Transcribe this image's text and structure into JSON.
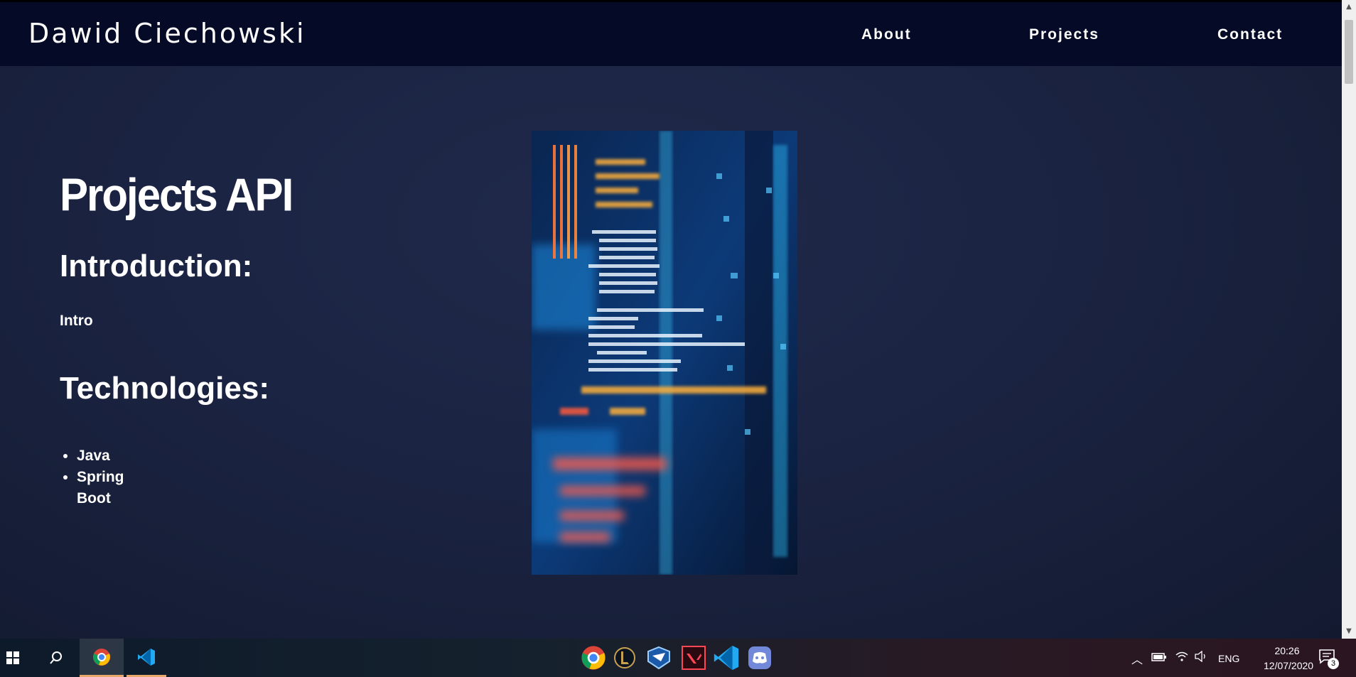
{
  "navbar": {
    "brand": "Dawid Ciechowski",
    "links": [
      "About",
      "Projects",
      "Contact"
    ]
  },
  "project": {
    "title": "Projects API",
    "intro_heading": "Introduction:",
    "intro_text": "Intro",
    "tech_heading": "Technologies:",
    "technologies": [
      "Java",
      "Spring Boot"
    ]
  },
  "taskbar": {
    "pinned": [
      "chrome-icon",
      "vscode-icon"
    ],
    "center_apps": [
      "chrome-icon",
      "league-of-legends-icon",
      "rocket-league-icon",
      "valorant-icon",
      "vscode-icon",
      "discord-icon"
    ],
    "language": "ENG",
    "time": "20:26",
    "date": "12/07/2020",
    "notification_count": "3"
  }
}
